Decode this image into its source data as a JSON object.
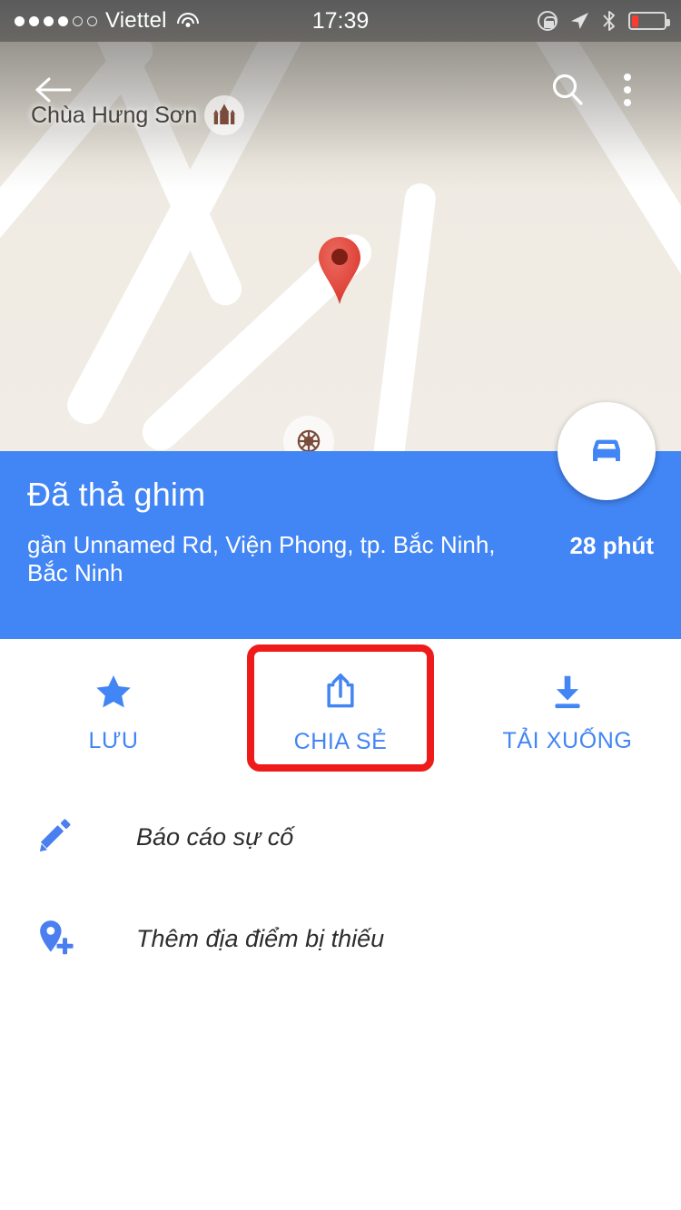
{
  "status_bar": {
    "carrier": "Viettel",
    "time": "17:39",
    "signal_dots_filled": 4,
    "signal_dots_total": 6,
    "battery_percent": 20,
    "battery_color": "#fb3b30",
    "icons": [
      "wifi-icon",
      "rotation-lock-icon",
      "location-arrow-icon",
      "bluetooth-icon",
      "battery-icon"
    ]
  },
  "topbar": {
    "back_label": "back-arrow",
    "search_label": "search",
    "overflow_label": "more-options"
  },
  "map": {
    "poi_label": "Chùa Hưng Sơn",
    "poi_icon": "temple-icon",
    "secondary_poi_icon": "dharma-wheel-icon",
    "pin_icon": "dropped-pin-marker",
    "background_color": "#efebe3",
    "road_color": "#ffffff"
  },
  "info_card": {
    "title": "Đã thả ghim",
    "address": "gần Unnamed Rd, Viện Phong, tp. Bắc Ninh, Bắc Ninh",
    "eta": "28 phút",
    "background_color": "#4285f4",
    "fab_icon": "car-directions-icon"
  },
  "actions": [
    {
      "id": "save",
      "label": "LƯU",
      "icon": "star-icon",
      "highlighted": false
    },
    {
      "id": "share",
      "label": "CHIA SẺ",
      "icon": "share-icon",
      "highlighted": true
    },
    {
      "id": "download",
      "label": "TẢI XUỐNG",
      "icon": "download-icon",
      "highlighted": false
    }
  ],
  "list_items": [
    {
      "id": "report-problem",
      "label": "Báo cáo sự cố",
      "icon": "pencil-icon"
    },
    {
      "id": "add-missing-place",
      "label": "Thêm địa điểm bị thiếu",
      "icon": "add-place-pin-icon"
    }
  ],
  "colors": {
    "accent_blue": "#4285f4",
    "highlight_red": "#ef1b1b",
    "text_dark": "#2d2d2d"
  }
}
